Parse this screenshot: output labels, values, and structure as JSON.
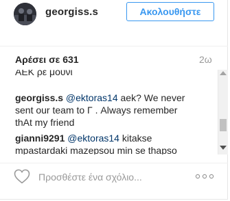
{
  "post": {
    "username": "georgiss.s",
    "follow_label": "Ακολουθήστε"
  },
  "likes": {
    "label": "Αρέσει σε 631",
    "time": "2ω"
  },
  "comments": [
    {
      "partial_text": "ΑΕΚ ρε μουνί"
    },
    {
      "username": "georgiss.s",
      "mention": "@ektoras14",
      "text_line1_rest": " aek? We never",
      "text_line2": "sent our team to Γ . Always remember",
      "text_line3": "thAt my friend"
    },
    {
      "username": "gianni9291",
      "mention": "@ektoras14",
      "text_line1_rest": " kitakse",
      "text_line2": "mpastardaki mazepsou min se thapso"
    }
  ],
  "composer": {
    "placeholder": "Προσθέστε ένα σχόλιο..."
  },
  "icons": {
    "like": "heart-outline-icon",
    "more": "ellipsis-icon"
  },
  "colors": {
    "accent": "#3897f0",
    "text": "#262626",
    "muted": "#999999"
  }
}
